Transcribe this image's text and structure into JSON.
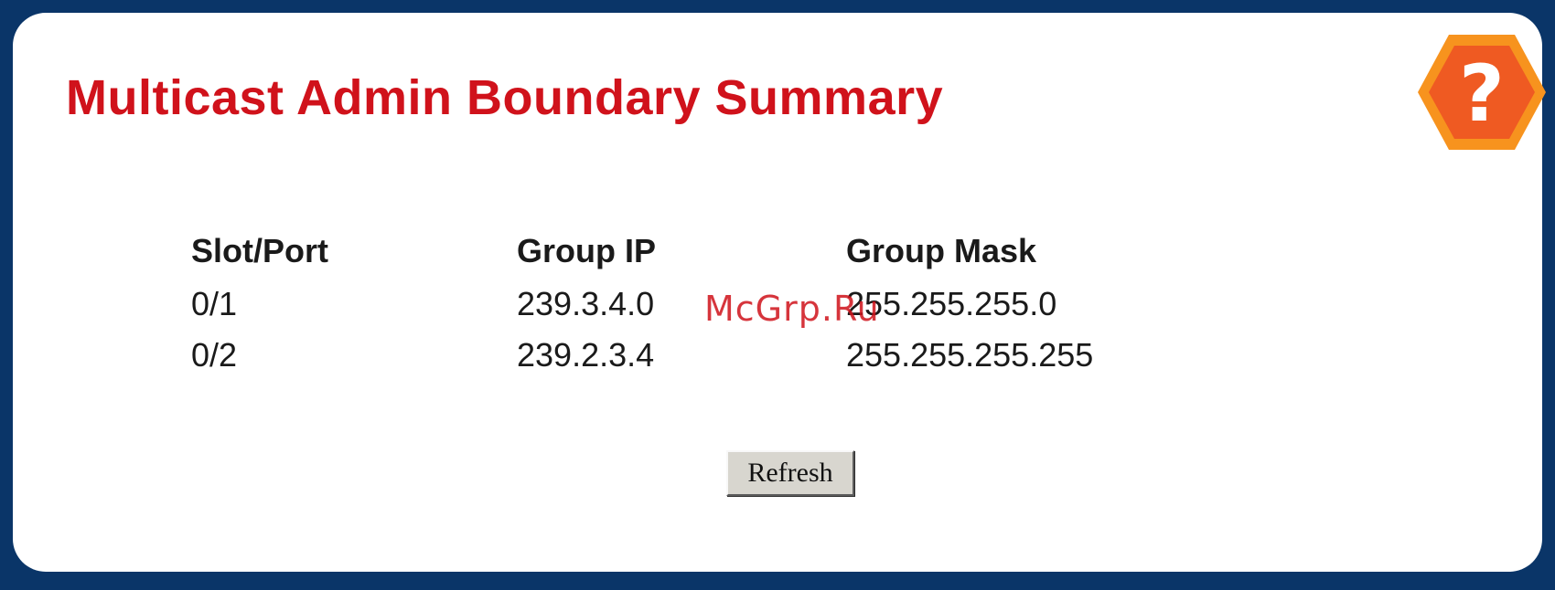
{
  "page": {
    "title": "Multicast Admin Boundary Summary"
  },
  "help": {
    "icon": "help-question-icon",
    "symbol": "?"
  },
  "table": {
    "columns": [
      "Slot/Port",
      "Group IP",
      "Group Mask"
    ],
    "rows": [
      [
        "0/1",
        "239.3.4.0",
        "255.255.255.0"
      ],
      [
        "0/2",
        "239.2.3.4",
        "255.255.255.255"
      ]
    ]
  },
  "actions": {
    "refresh_label": "Refresh"
  },
  "watermark": {
    "text": "McGrp.Ru"
  },
  "colors": {
    "background": "#0a3568",
    "title": "#d0121b",
    "help_outer": "#f7931e",
    "help_inner": "#ef5a22"
  }
}
